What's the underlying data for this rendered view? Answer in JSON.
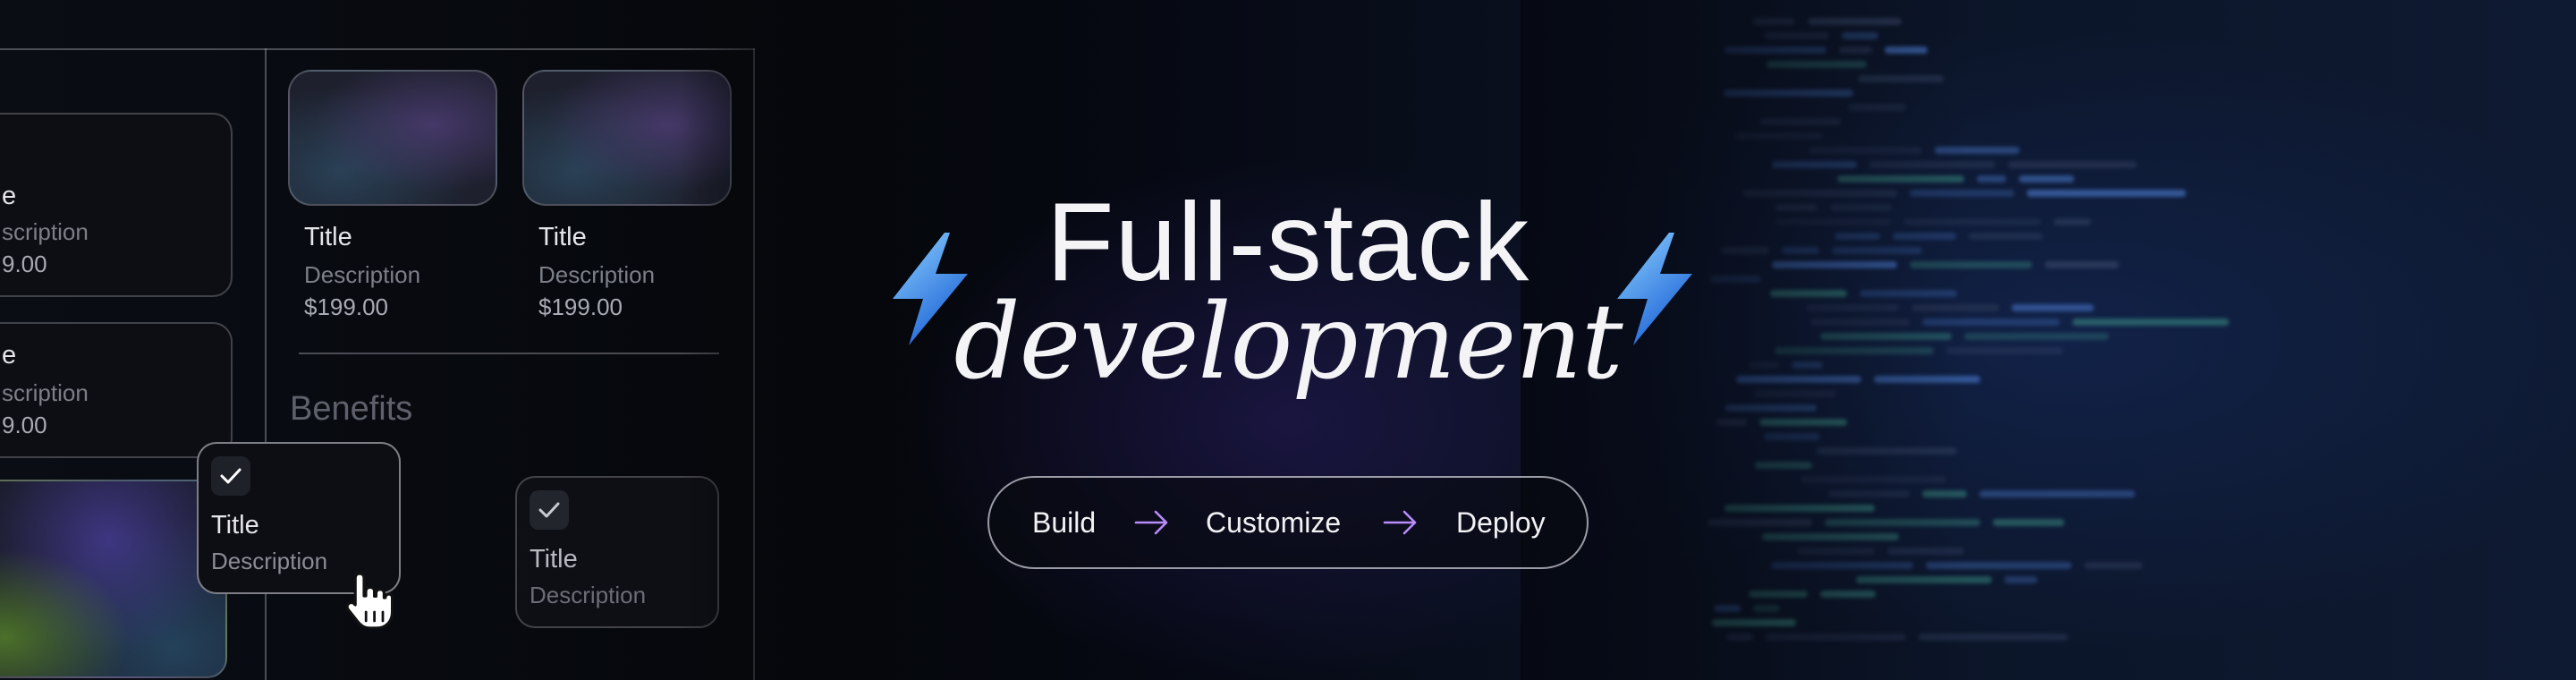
{
  "hero": {
    "title": "Full-stack",
    "subtitle": "development",
    "steps": [
      "Build",
      "Customize",
      "Deploy"
    ]
  },
  "mockup": {
    "left_cards": [
      {
        "title": "e",
        "description": "scription",
        "price": "9.00"
      },
      {
        "title": "e",
        "description": "scription",
        "price": "9.00"
      }
    ],
    "product_cards": [
      {
        "title": "Title",
        "description": "Description",
        "price": "$199.00"
      },
      {
        "title": "Title",
        "description": "Description",
        "price": "$199.00"
      }
    ],
    "benefits": {
      "heading": "Benefits",
      "items": [
        {
          "title": "Title",
          "description": "Description",
          "checked": true
        },
        {
          "title": "Title",
          "description": "Description",
          "checked": true
        }
      ]
    }
  },
  "colors": {
    "bolt_light": "#7fc8ff",
    "bolt_dark": "#1f6fe0",
    "arrow": "#b98cff",
    "code_keyword": "#4d7fd6",
    "code_string": "#3f9a8c",
    "code_plain": "#3a4a6a"
  },
  "icons": {
    "bolt": "lightning-bolt-icon",
    "arrow": "arrow-right-icon",
    "check": "checkmark-icon",
    "cursor": "hand-pointer-icon"
  }
}
